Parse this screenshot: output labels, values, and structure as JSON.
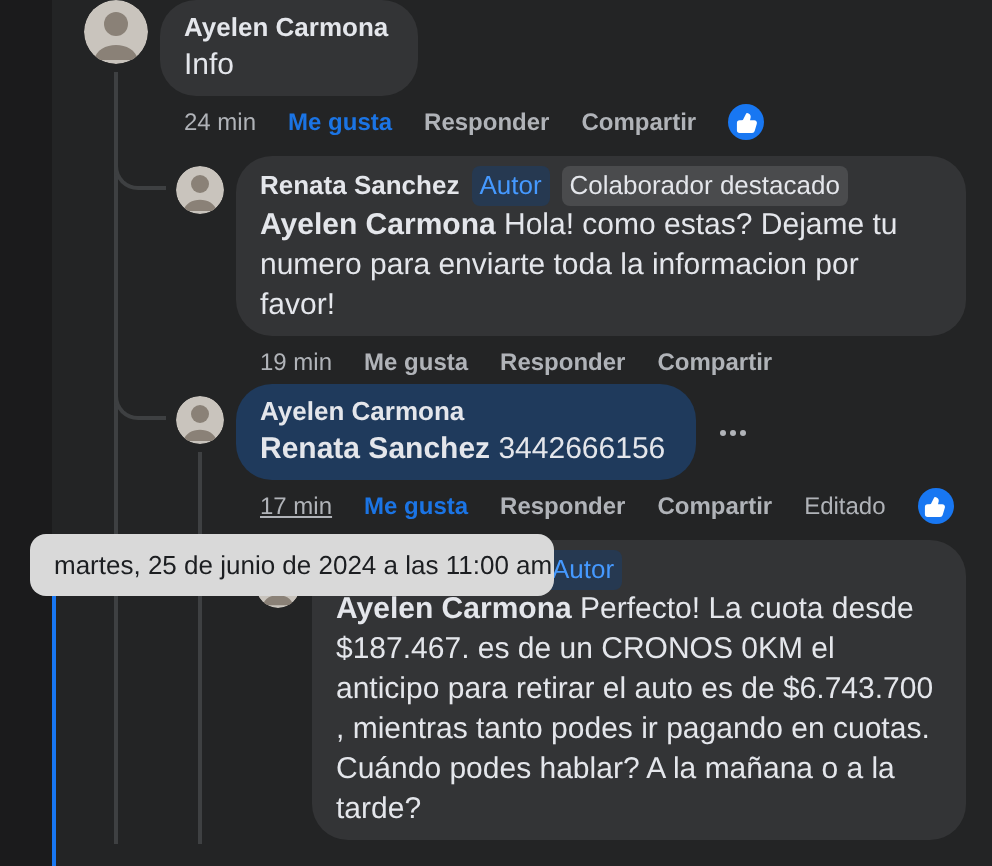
{
  "comments": [
    {
      "author": "Ayelen Carmona",
      "text": "Info",
      "time": "24 min",
      "time_hovered": false,
      "liked": true,
      "highlighted": false,
      "reaction": true,
      "actions": [
        {
          "label": "Me gusta",
          "kind": "like"
        },
        {
          "label": "Responder",
          "kind": "reply"
        },
        {
          "label": "Compartir",
          "kind": "share"
        }
      ],
      "children": [
        {
          "author": "Renata Sanchez",
          "badges": [
            {
              "label": "Autor",
              "kind": "author"
            },
            {
              "label": "Colaborador destacado",
              "kind": "top_fan"
            }
          ],
          "mention": "Ayelen Carmona",
          "text": "Hola! como estas? Dejame tu numero para enviarte toda la informacion por favor!",
          "time": "19 min",
          "time_hovered": false,
          "liked": false,
          "highlighted": false,
          "actions": [
            {
              "label": "Me gusta",
              "kind": "like"
            },
            {
              "label": "Responder",
              "kind": "reply"
            },
            {
              "label": "Compartir",
              "kind": "share"
            }
          ]
        },
        {
          "author": "Ayelen Carmona",
          "mention": "Renata Sanchez",
          "text": "3442666156",
          "time": "17 min",
          "time_hovered": true,
          "liked": true,
          "highlighted": true,
          "reaction": true,
          "more_menu": true,
          "edited": "Editado",
          "actions": [
            {
              "label": "Me gusta",
              "kind": "like"
            },
            {
              "label": "Responder",
              "kind": "reply"
            },
            {
              "label": "Compartir",
              "kind": "share"
            }
          ],
          "children": [
            {
              "badges": [
                {
                  "label": "Autor",
                  "kind": "author"
                }
              ],
              "mention": "Ayelen Carmona",
              "text": "Perfecto! La cuota desde $187.467. es de un CRONOS 0KM el anticipo para retirar el auto es de $6.743.700 , mientras tanto podes ir pagando en cuotas. Cuándo podes hablar? A la mañana o a la tarde?",
              "highlighted": false
            }
          ]
        }
      ]
    }
  ],
  "tooltip": {
    "text": "martes, 25 de junio de 2024 a las 11:00 am"
  }
}
